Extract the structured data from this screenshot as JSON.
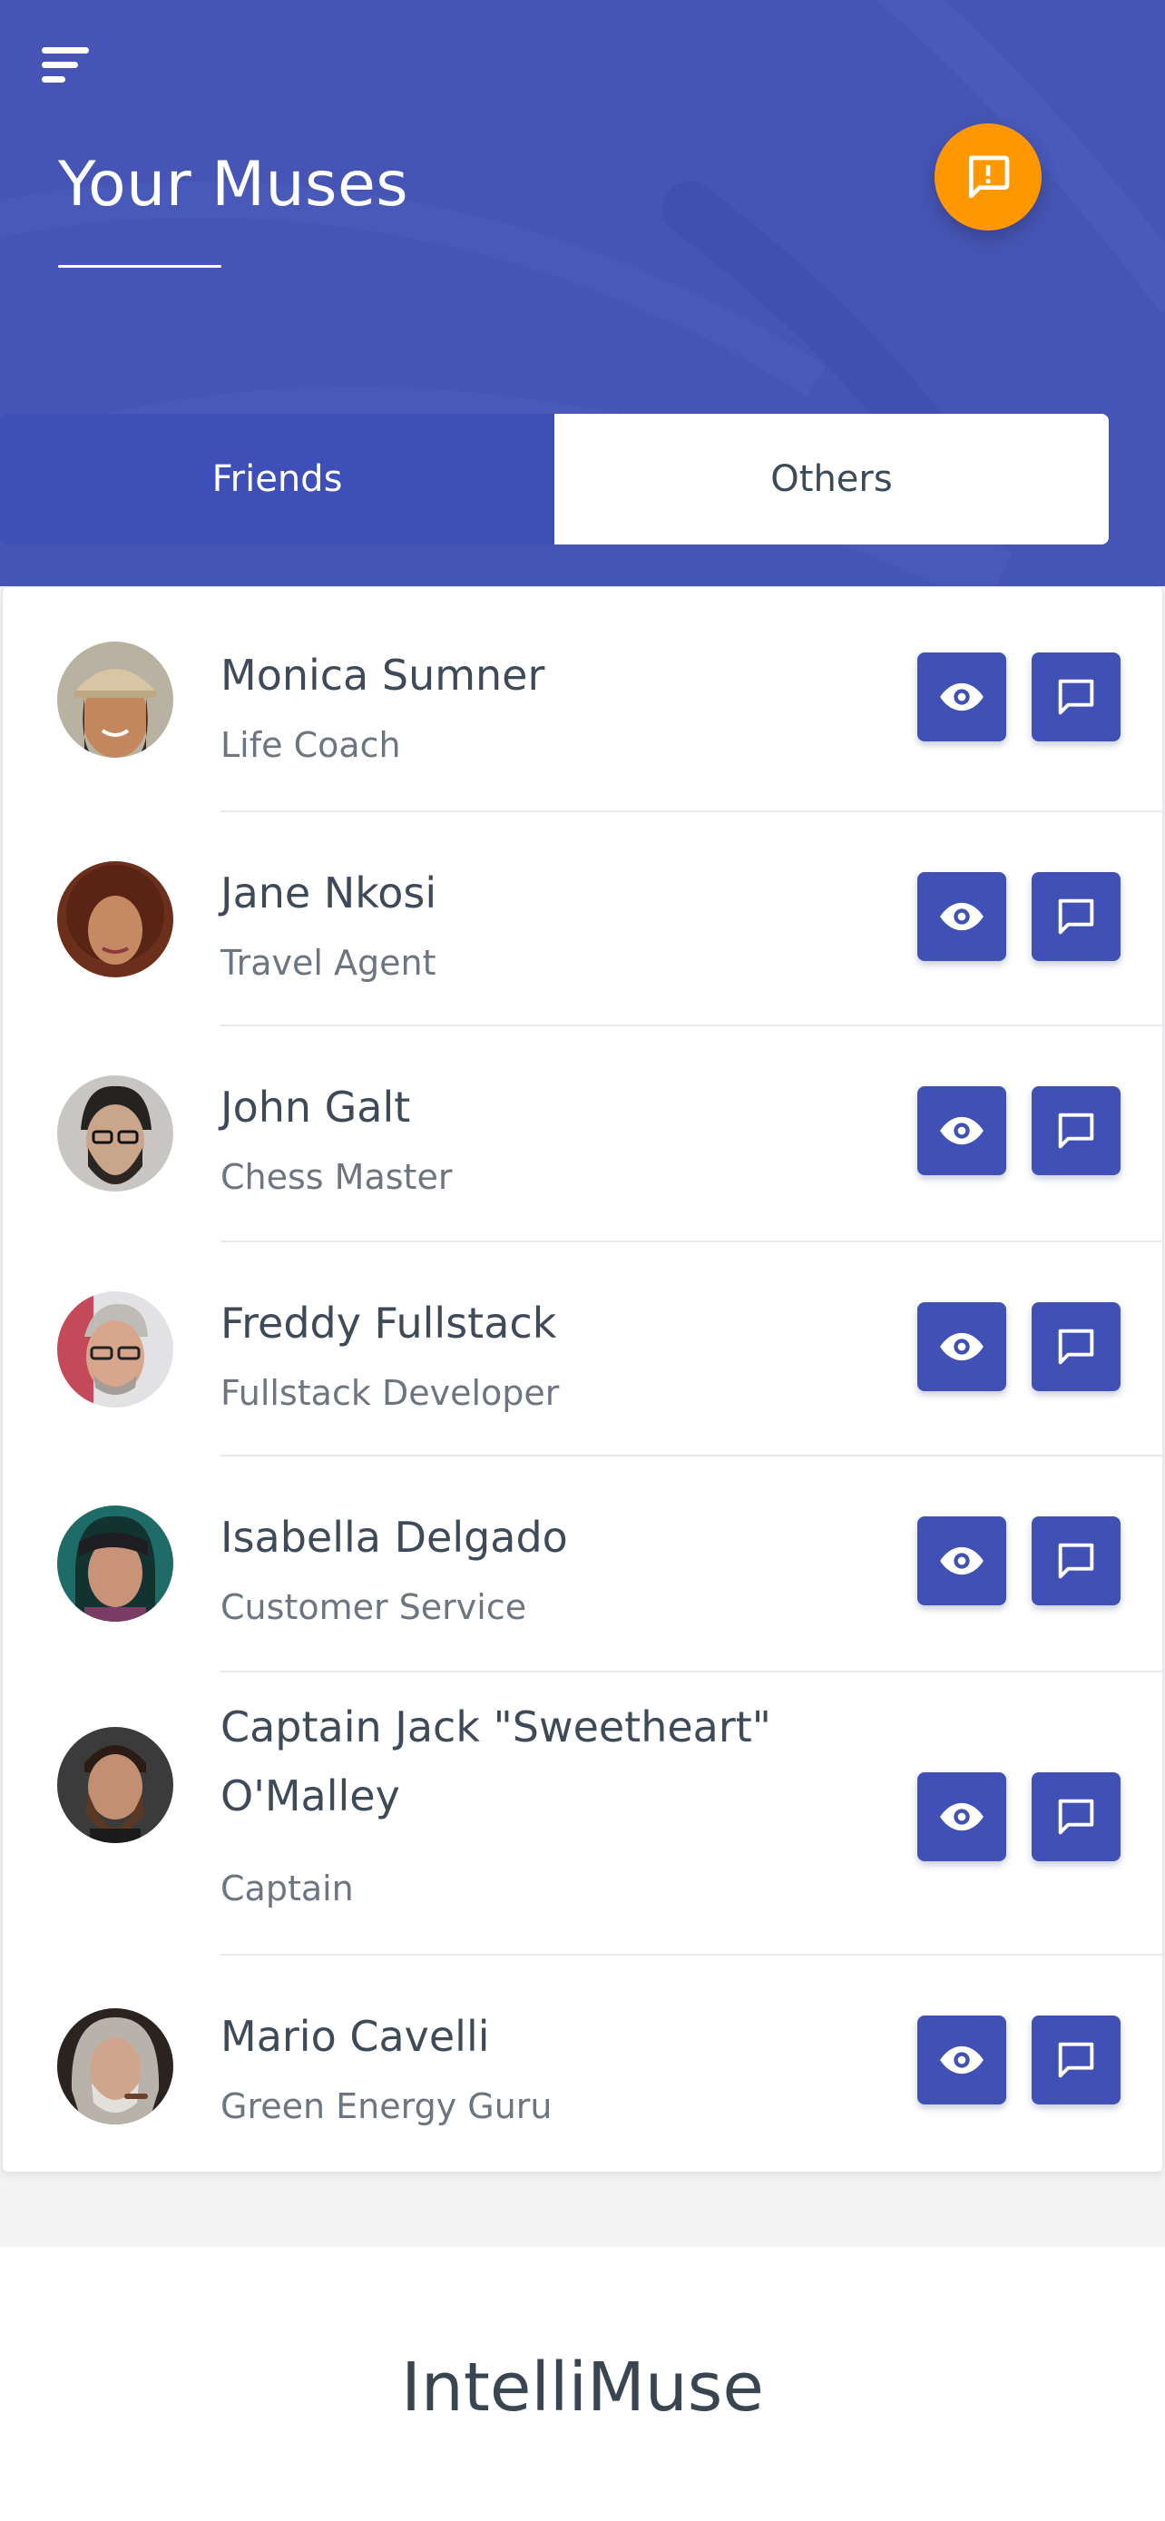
{
  "header": {
    "title": "Your Muses",
    "menu_icon": "menu-icon",
    "feedback_icon": "feedback-alert-icon",
    "background_color": "#4655b5",
    "feedback_color": "#ff9800"
  },
  "tabs": [
    {
      "label": "Friends",
      "active": true
    },
    {
      "label": "Others",
      "active": false
    }
  ],
  "muses": [
    {
      "name": "Monica Sumner",
      "role": "Life Coach"
    },
    {
      "name": "Jane Nkosi",
      "role": "Travel Agent"
    },
    {
      "name": "John Galt",
      "role": "Chess Master"
    },
    {
      "name": "Freddy Fullstack",
      "role": "Fullstack Developer"
    },
    {
      "name": "Isabella Delgado",
      "role": "Customer Service"
    },
    {
      "name": "Captain Jack \"Sweetheart\" O'Malley",
      "role": "Captain"
    },
    {
      "name": "Mario Cavelli",
      "role": "Green Energy Guru"
    }
  ],
  "row_actions": {
    "view_icon": "eye-icon",
    "chat_icon": "message-square-icon",
    "button_color": "#4150b5"
  },
  "footer": {
    "brand": "IntelliMuse"
  }
}
